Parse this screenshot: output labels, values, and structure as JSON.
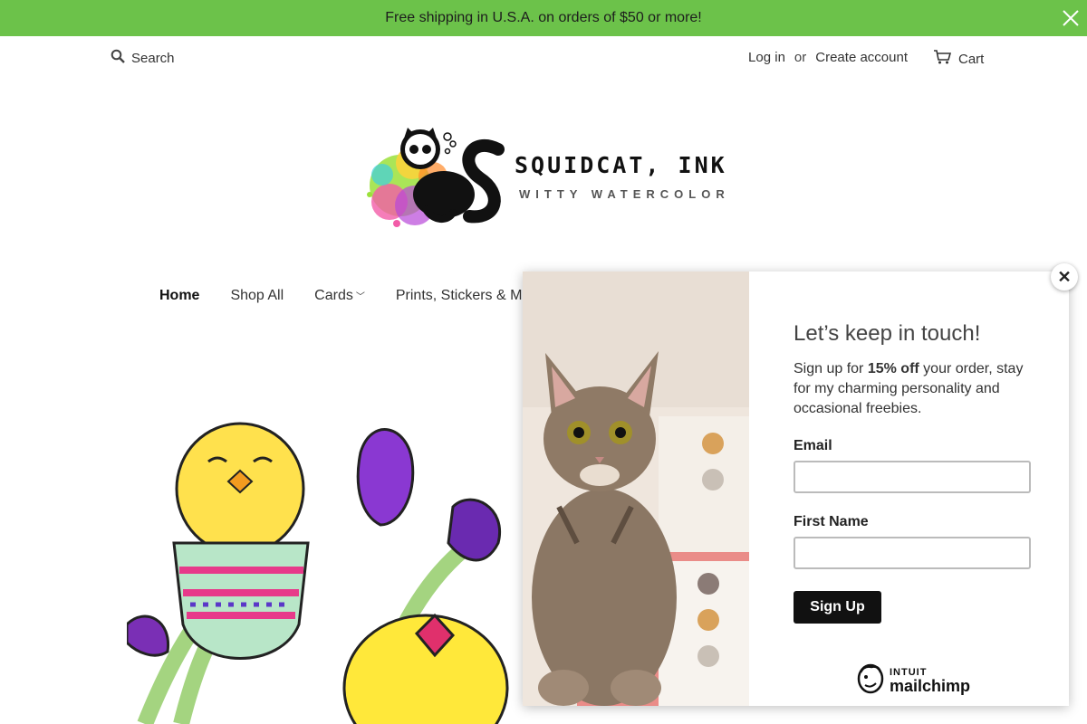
{
  "announcement": {
    "text": "Free shipping in U.S.A. on orders of $50 or more!",
    "bg_color": "#6cc24a"
  },
  "header": {
    "search_label": "Search",
    "login_label": "Log in",
    "or_label": "or",
    "create_account_label": "Create account",
    "cart_label": "Cart"
  },
  "logo": {
    "brand_name": "SQUIDCAT, INK",
    "tagline": "WITTY WATERCOLOR"
  },
  "nav": {
    "items": [
      {
        "label": "Home"
      },
      {
        "label": "Shop All"
      },
      {
        "label": "Cards"
      },
      {
        "label": "Prints, Stickers & M"
      }
    ]
  },
  "popup": {
    "title": "Let’s keep in touch!",
    "text_pre": "Sign up for ",
    "text_bold": "15% off",
    "text_post": " your order, stay for my charming personality and occasional freebies.",
    "email_label": "Email",
    "email_value": "",
    "first_name_label": "First Name",
    "first_name_value": "",
    "signup_label": "Sign Up",
    "mailchimp_intuit": "INTUIT",
    "mailchimp_name": "mailchimp",
    "close_label": "✕"
  },
  "colors": {
    "accent": "#6cc24a",
    "button_bg": "#111111"
  }
}
